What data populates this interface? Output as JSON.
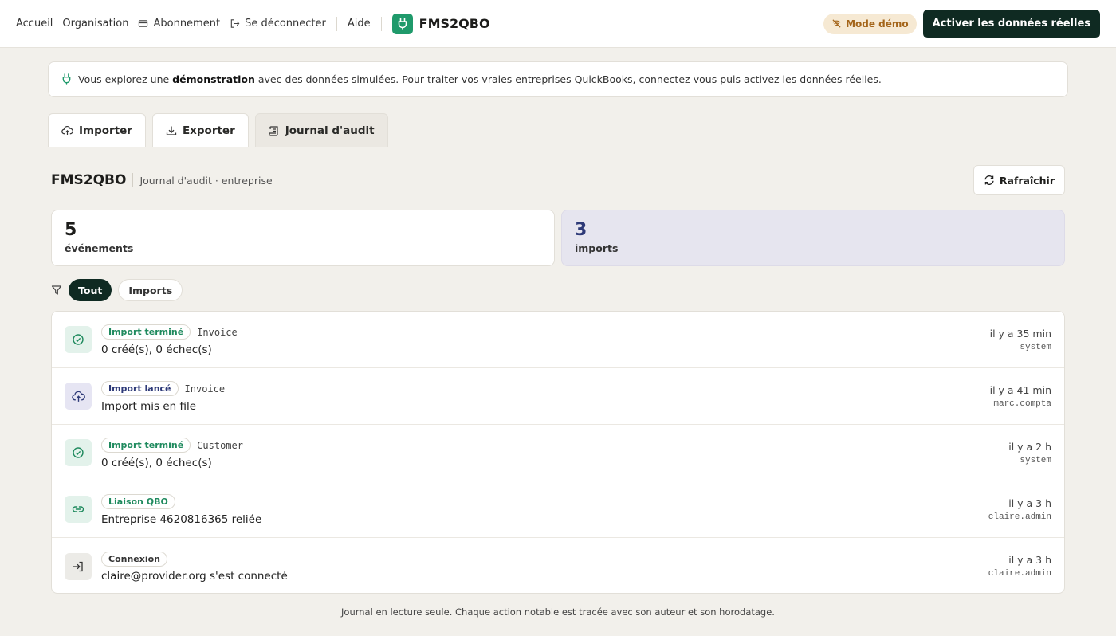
{
  "nav": {
    "home": "Accueil",
    "organisation": "Organisation",
    "subscription": "Abonnement",
    "logout": "Se déconnecter",
    "help": "Aide",
    "brand": "FMS2QBO",
    "demo_mode": "Mode démo",
    "activate": "Activer les données réelles"
  },
  "banner": {
    "prefix": "Vous explorez une ",
    "bold": "démonstration",
    "suffix": " avec des données simulées. Pour traiter vos vraies entreprises QuickBooks, connectez-vous puis activez les données réelles."
  },
  "tabs": [
    {
      "label": "Importer",
      "icon": "upload-cloud-icon"
    },
    {
      "label": "Exporter",
      "icon": "download-icon"
    },
    {
      "label": "Journal d'audit",
      "icon": "scroll-icon",
      "active": true
    }
  ],
  "header": {
    "title": "FMS2QBO",
    "subtitle": "Journal d'audit · entreprise",
    "refresh": "Rafraîchir"
  },
  "stats": {
    "events_count": "5",
    "events_label": "événements",
    "imports_count": "3",
    "imports_label": "imports"
  },
  "filters": {
    "all": "Tout",
    "imports": "Imports"
  },
  "events": [
    {
      "badge": "Import terminé",
      "tone": "green",
      "entity": "Invoice",
      "desc": "0 créé(s), 0 échec(s)",
      "time": "il y a 35 min",
      "user": "system",
      "icon": "check-circle-icon"
    },
    {
      "badge": "Import lancé",
      "tone": "violet",
      "entity": "Invoice",
      "desc": "Import mis en file",
      "time": "il y a 41 min",
      "user": "marc.compta",
      "icon": "upload-cloud-icon"
    },
    {
      "badge": "Import terminé",
      "tone": "green",
      "entity": "Customer",
      "desc": "0 créé(s), 0 échec(s)",
      "time": "il y a 2 h",
      "user": "system",
      "icon": "check-circle-icon"
    },
    {
      "badge": "Liaison QBO",
      "tone": "green",
      "entity": "",
      "desc": "Entreprise 4620816365 reliée",
      "time": "il y a 3 h",
      "user": "claire.admin",
      "icon": "link-icon"
    },
    {
      "badge": "Connexion",
      "tone": "grey",
      "entity": "",
      "desc": "claire@provider.org s'est connecté",
      "time": "il y a 3 h",
      "user": "claire.admin",
      "icon": "login-icon"
    }
  ],
  "footer": "Journal en lecture seule. Chaque action notable est tracée avec son auteur et son horodatage.",
  "colors": {
    "brand_green": "#1f9a6b",
    "dark": "#0f2a22",
    "violet": "#2e3a78",
    "demo_bg": "#f6e9d3",
    "demo_fg": "#a4651a"
  }
}
